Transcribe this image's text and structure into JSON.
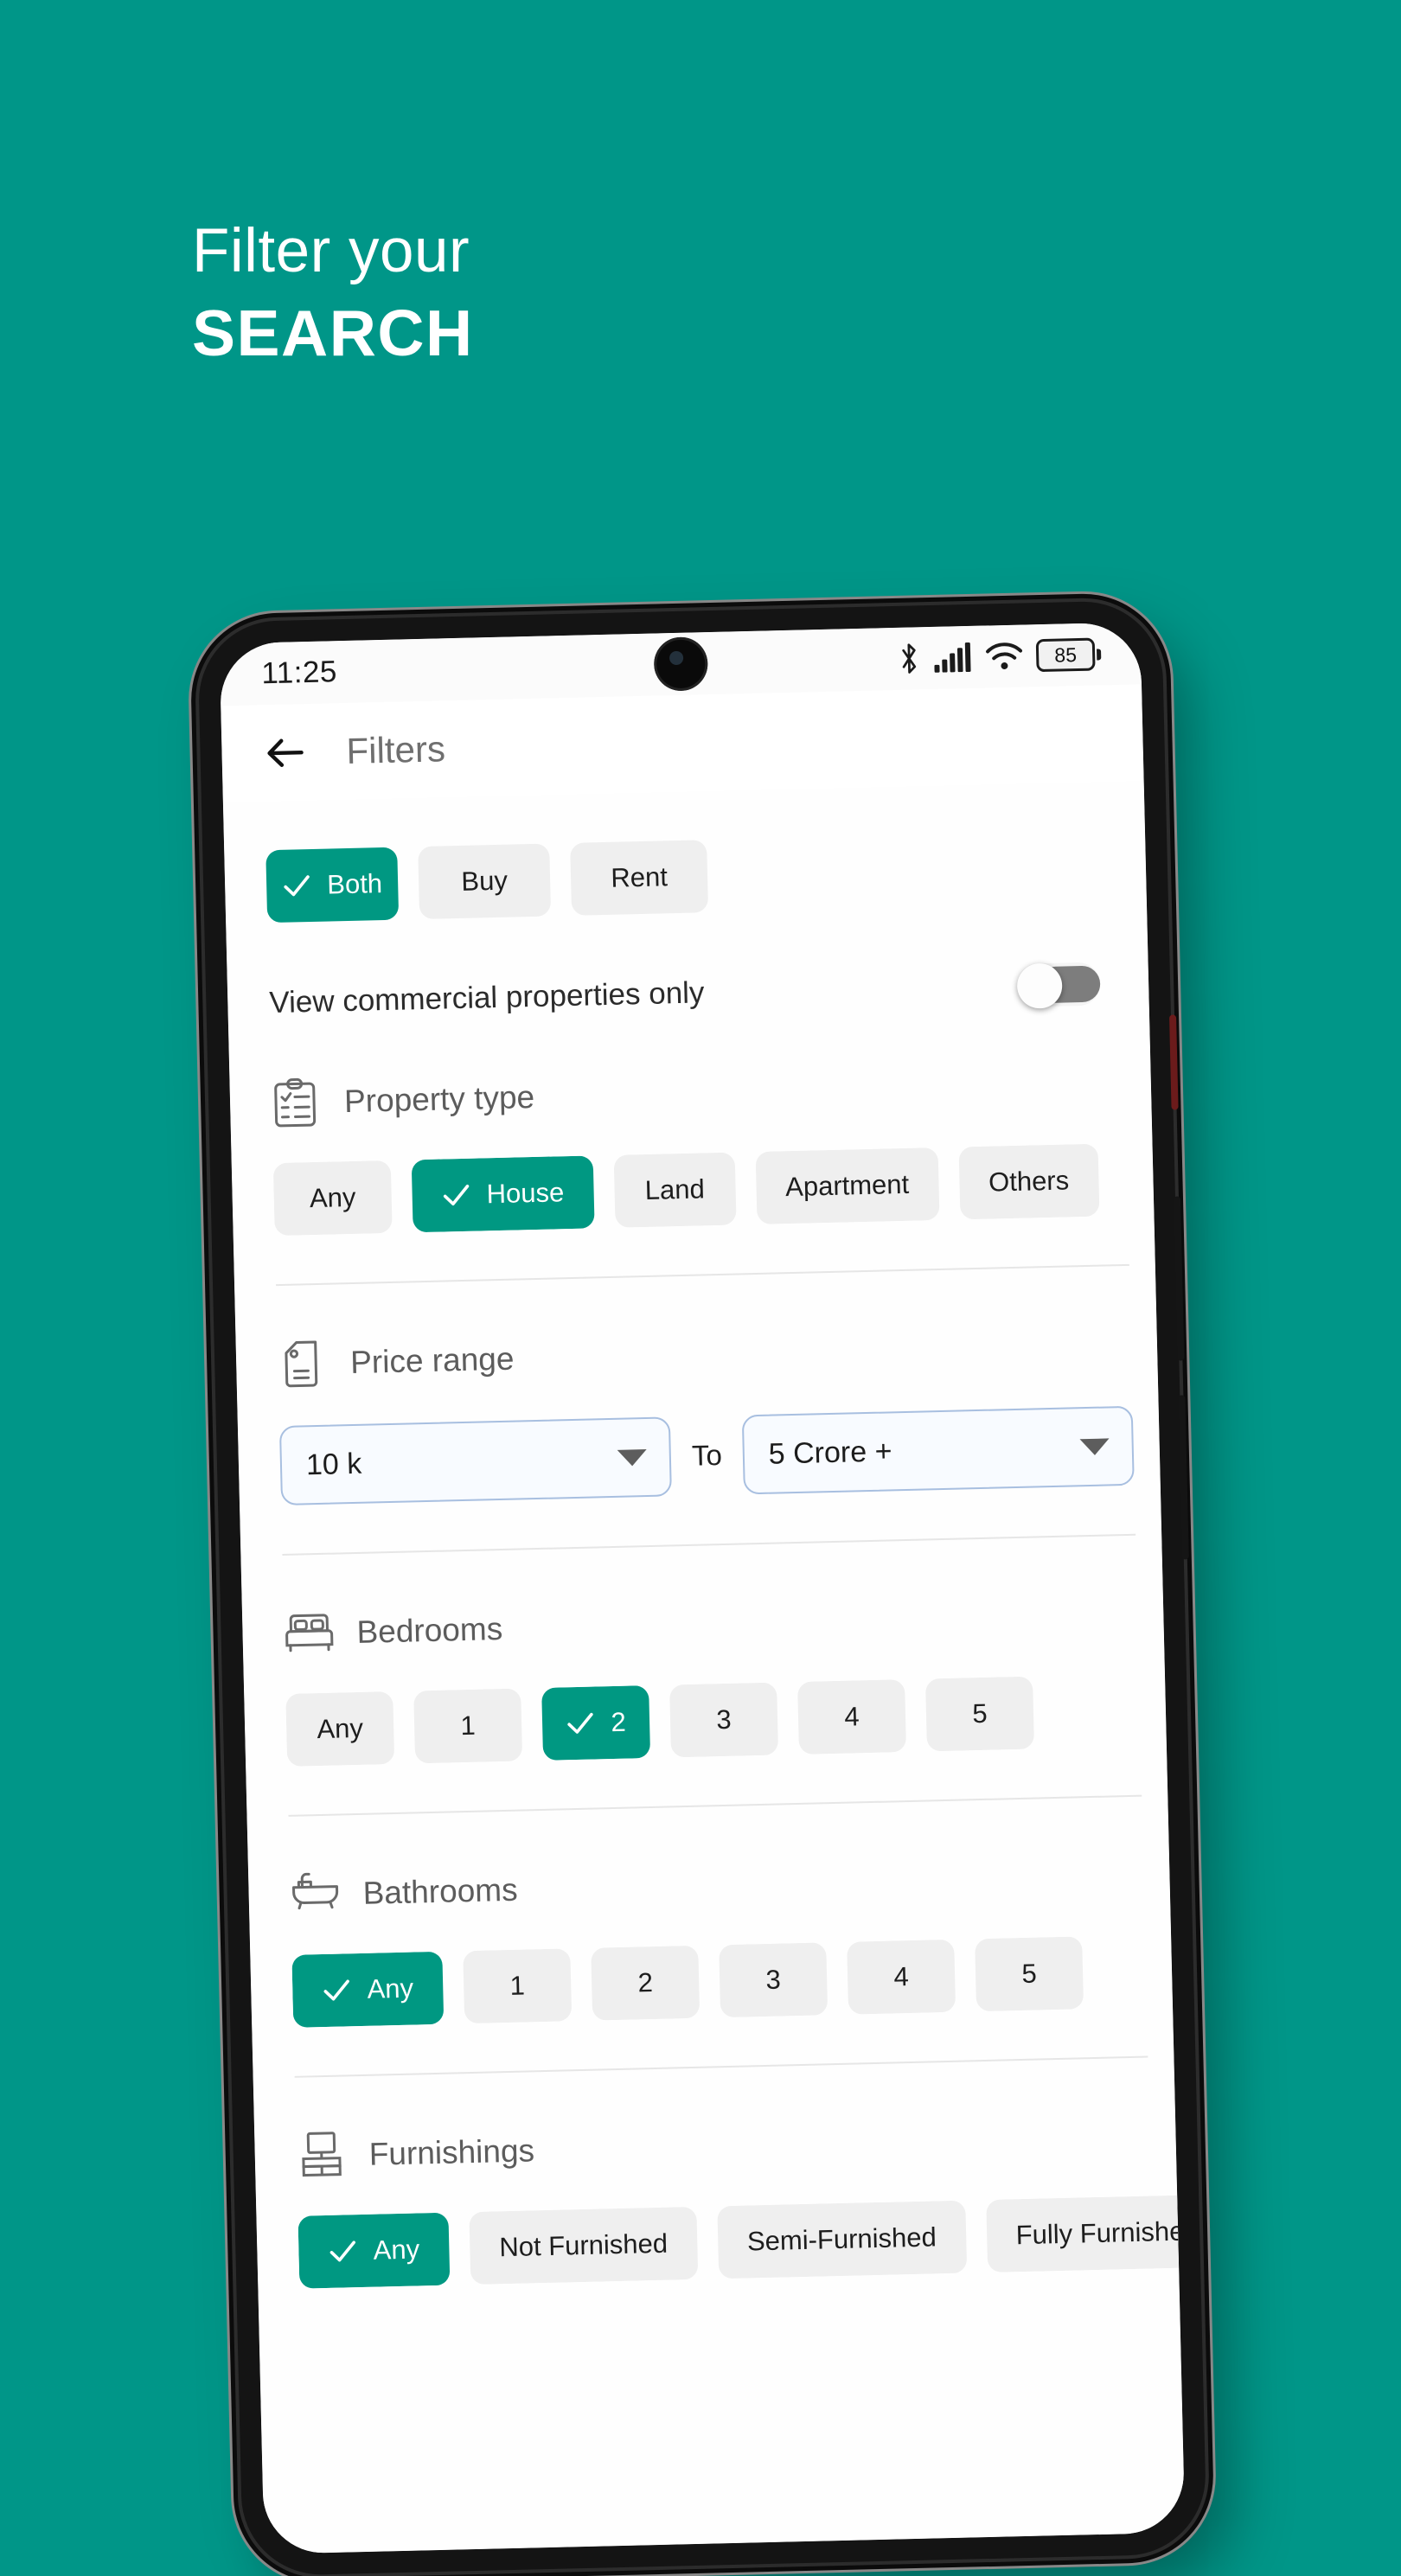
{
  "promo": {
    "line1": "Filter your",
    "line2": "SEARCH"
  },
  "theme": {
    "background": "#009688",
    "accent": "#009882",
    "chip_bg": "#efefef",
    "dropdown_border": "#a8bfe0"
  },
  "statusbar": {
    "time": "11:25",
    "battery_percent": "85",
    "icons": [
      "bluetooth-icon",
      "signal-icon",
      "wifi-icon",
      "battery-icon"
    ]
  },
  "appbar": {
    "back_icon": "back-arrow-icon",
    "title": "Filters"
  },
  "listing_type": {
    "options": [
      {
        "label": "Both",
        "selected": true
      },
      {
        "label": "Buy",
        "selected": false
      },
      {
        "label": "Rent",
        "selected": false
      }
    ]
  },
  "commercial_toggle": {
    "label": "View commercial properties only",
    "state": "off"
  },
  "property_type": {
    "icon": "clipboard-checklist-icon",
    "title": "Property type",
    "options": [
      {
        "label": "Any",
        "selected": false
      },
      {
        "label": "House",
        "selected": true
      },
      {
        "label": "Land",
        "selected": false
      },
      {
        "label": "Apartment",
        "selected": false
      },
      {
        "label": "Others",
        "selected": false
      }
    ]
  },
  "price_range": {
    "icon": "price-tag-icon",
    "title": "Price range",
    "min_value": "10 k",
    "separator": "To",
    "max_value": "5 Crore +"
  },
  "bedrooms": {
    "icon": "bed-icon",
    "title": "Bedrooms",
    "options": [
      {
        "label": "Any",
        "selected": false
      },
      {
        "label": "1",
        "selected": false
      },
      {
        "label": "2",
        "selected": true
      },
      {
        "label": "3",
        "selected": false
      },
      {
        "label": "4",
        "selected": false
      },
      {
        "label": "5",
        "selected": false
      }
    ]
  },
  "bathrooms": {
    "icon": "bathtub-icon",
    "title": "Bathrooms",
    "options": [
      {
        "label": "Any",
        "selected": true
      },
      {
        "label": "1",
        "selected": false
      },
      {
        "label": "2",
        "selected": false
      },
      {
        "label": "3",
        "selected": false
      },
      {
        "label": "4",
        "selected": false
      },
      {
        "label": "5",
        "selected": false
      }
    ]
  },
  "furnishings": {
    "icon": "furniture-icon",
    "title": "Furnishings",
    "options": [
      {
        "label": "Any",
        "selected": true
      },
      {
        "label": "Not Furnished",
        "selected": false
      },
      {
        "label": "Semi-Furnished",
        "selected": false
      },
      {
        "label": "Fully Furnished",
        "selected": false
      }
    ]
  }
}
